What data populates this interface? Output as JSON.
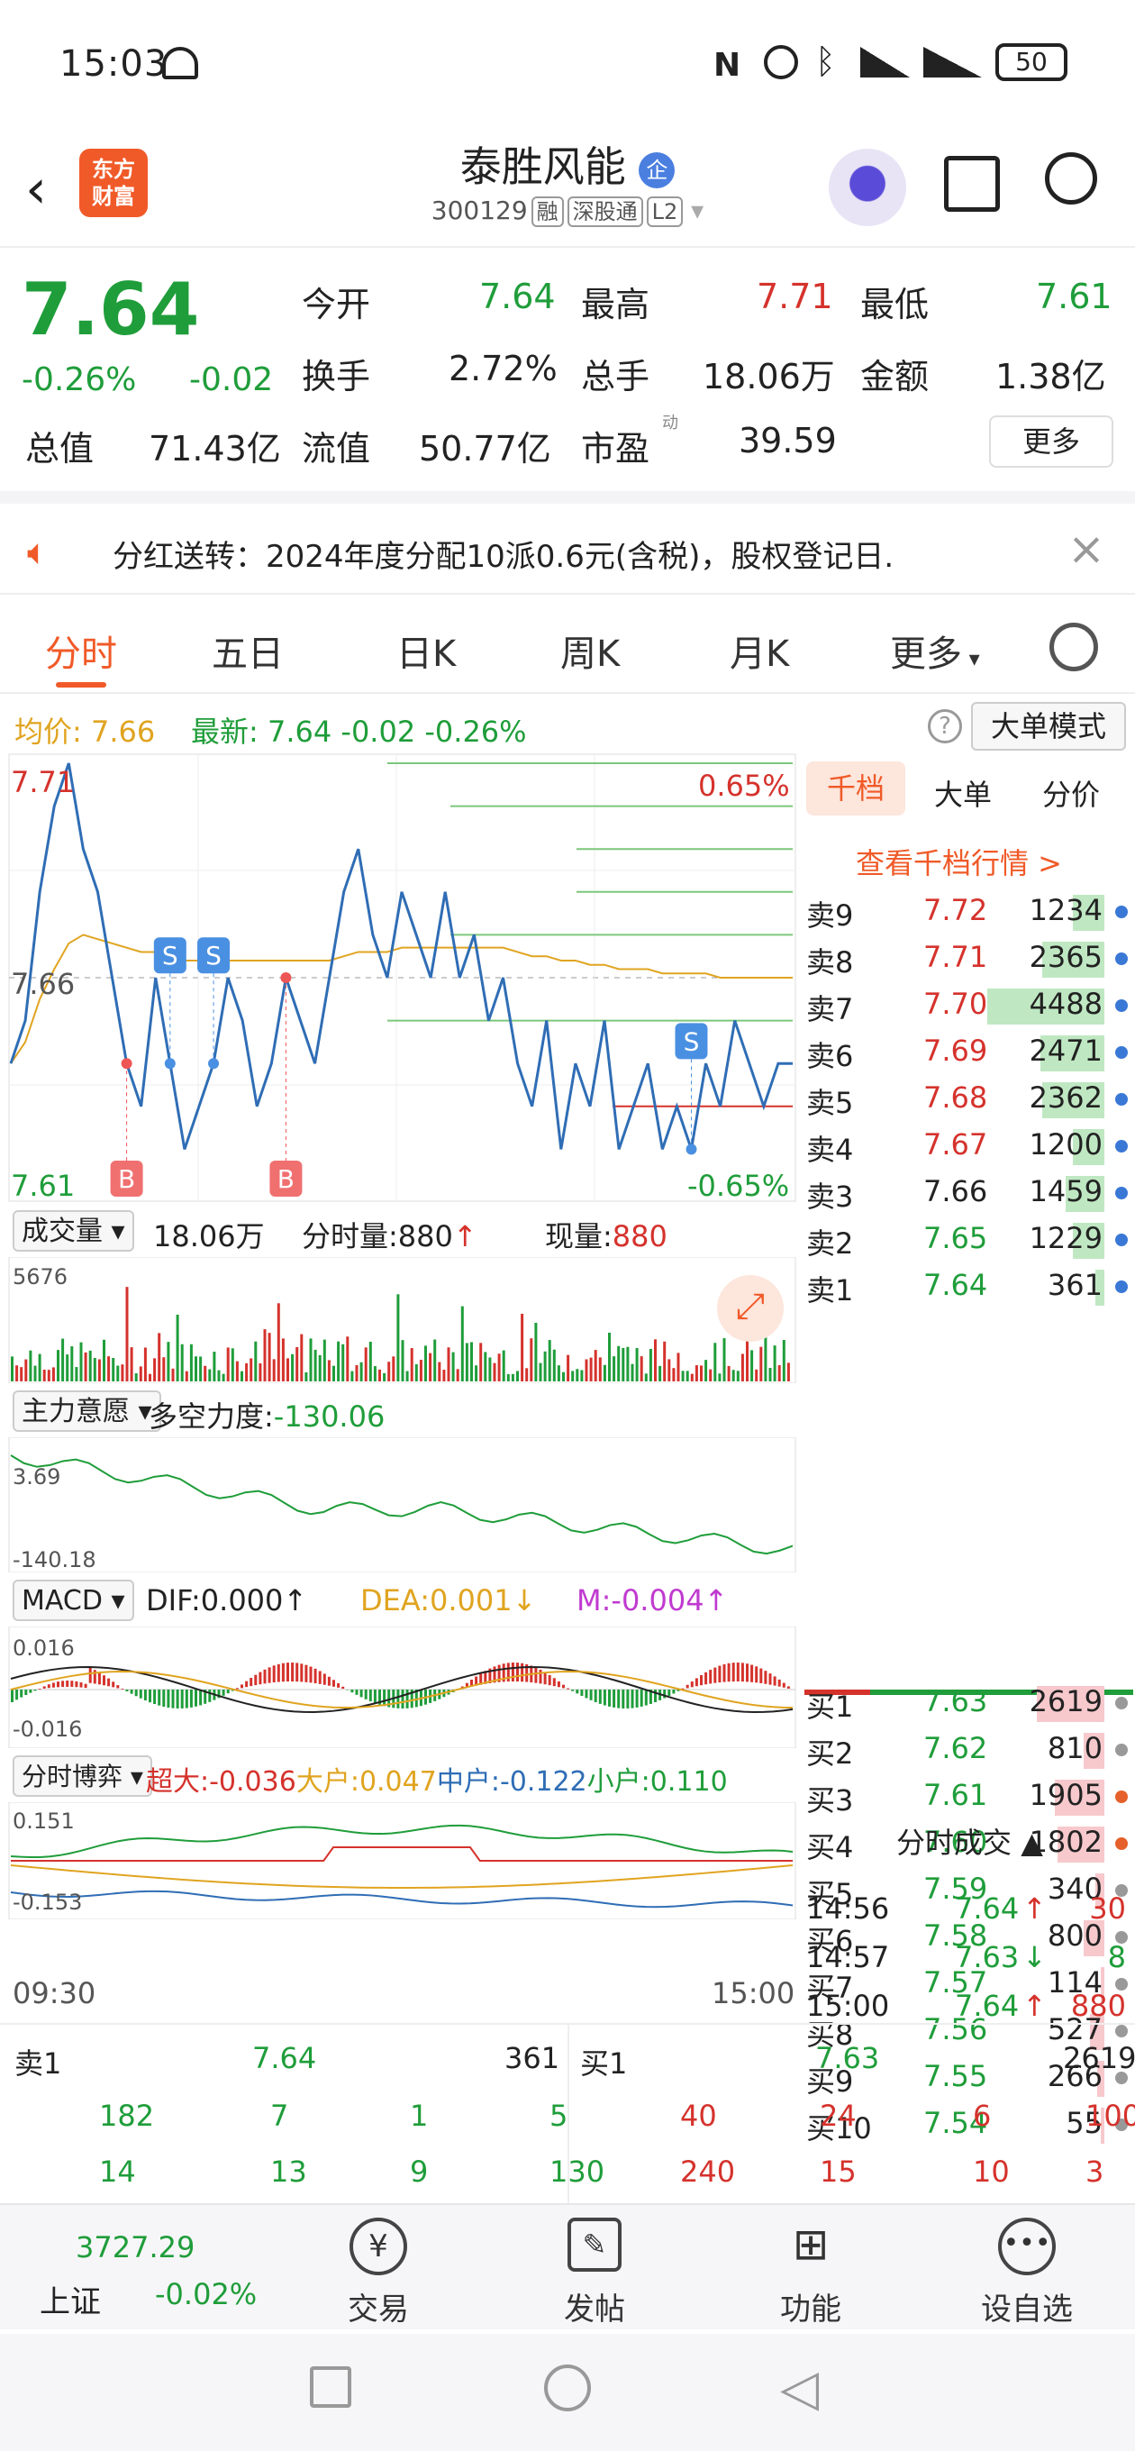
{
  "status": {
    "time": "15:03",
    "battery": "50"
  },
  "header": {
    "logo_line1": "东方",
    "logo_line2": "财富",
    "stock_name": "泰胜风能",
    "badge": "企",
    "code": "300129",
    "tags": [
      "融",
      "深股通",
      "L2"
    ]
  },
  "quote": {
    "price": "7.64",
    "change_pct": "-0.26%",
    "change": "-0.02",
    "open_label": "今开",
    "open": "7.64",
    "high_label": "最高",
    "high": "7.71",
    "low_label": "最低",
    "low": "7.61",
    "turnover_label": "换手",
    "turnover": "2.72%",
    "volume_label": "总手",
    "volume": "18.06万",
    "amount_label": "金额",
    "amount": "1.38亿",
    "mcap_label": "总值",
    "mcap": "71.43亿",
    "float_label": "流值",
    "float": "50.77亿",
    "pe_label": "市盈",
    "pe_sup": "动",
    "pe": "39.59",
    "more": "更多"
  },
  "notice": {
    "text": "分红送转：2024年度分配10派0.6元(含税)，股权登记日."
  },
  "tabs": [
    "分时",
    "五日",
    "日K",
    "周K",
    "月K",
    "更多"
  ],
  "legend": {
    "avg_label": "均价:",
    "avg": "7.66",
    "latest_label": "最新:",
    "latest": "7.64",
    "chg": "-0.02",
    "chg_pct": "-0.26%",
    "mode": "大单模式"
  },
  "chart": {
    "y_high": "7.71",
    "y_mid": "7.66",
    "y_low": "7.61",
    "pct_high": "0.65%",
    "pct_low": "-0.65%",
    "time_start": "09:30",
    "time_end": "15:00",
    "sell_marker": "S",
    "buy_marker": "B",
    "price_series": [
      7.64,
      7.65,
      7.68,
      7.7,
      7.71,
      7.69,
      7.68,
      7.66,
      7.64,
      7.63,
      7.66,
      7.64,
      7.62,
      7.63,
      7.64,
      7.66,
      7.65,
      7.63,
      7.64,
      7.66,
      7.65,
      7.64,
      7.66,
      7.68,
      7.69,
      7.67,
      7.66,
      7.68,
      7.67,
      7.66,
      7.68,
      7.66,
      7.67,
      7.65,
      7.66,
      7.64,
      7.63,
      7.65,
      7.62,
      7.64,
      7.63,
      7.65,
      7.62,
      7.63,
      7.64,
      7.62,
      7.63,
      7.62,
      7.64,
      7.63,
      7.65,
      7.64,
      7.63,
      7.64,
      7.64
    ],
    "avg_series": [
      7.64,
      7.645,
      7.655,
      7.662,
      7.668,
      7.67,
      7.669,
      7.668,
      7.667,
      7.666,
      7.666,
      7.665,
      7.664,
      7.664,
      7.664,
      7.664,
      7.664,
      7.664,
      7.664,
      7.664,
      7.664,
      7.664,
      7.664,
      7.665,
      7.666,
      7.666,
      7.666,
      7.667,
      7.667,
      7.667,
      7.667,
      7.667,
      7.667,
      7.667,
      7.667,
      7.666,
      7.665,
      7.665,
      7.664,
      7.664,
      7.663,
      7.663,
      7.662,
      7.662,
      7.662,
      7.661,
      7.661,
      7.661,
      7.661,
      7.66,
      7.66,
      7.66,
      7.66,
      7.66,
      7.66
    ]
  },
  "volume": {
    "label": "成交量",
    "total": "18.06万",
    "fs_label": "分时量:",
    "fs_value": "880",
    "now_label": "现量:",
    "now_value": "880",
    "max": "5676"
  },
  "main_force": {
    "label": "主力意愿",
    "title": "多空力度:",
    "value": "-130.06",
    "top": "3.69",
    "bottom": "-140.18"
  },
  "macd": {
    "label": "MACD",
    "dif": "DIF:0.000",
    "dea": "DEA:0.001",
    "m": "M:-0.004",
    "top": "0.016",
    "bottom": "-0.016"
  },
  "game": {
    "label": "分时博弈",
    "super_label": "超大:",
    "super": "-0.036",
    "big_label": "大户:",
    "big": "0.047",
    "mid_label": "中户:",
    "mid": "-0.122",
    "small_label": "小户:",
    "small": "0.110",
    "top": "0.151",
    "bottom": "-0.153"
  },
  "orderbook": {
    "tabs": [
      "千档",
      "大单",
      "分价"
    ],
    "link": "查看千档行情 >",
    "asks": [
      {
        "label": "卖9",
        "price": "7.72",
        "vol": "1234",
        "pct": 0.27
      },
      {
        "label": "卖8",
        "price": "7.71",
        "vol": "2365",
        "pct": 0.53
      },
      {
        "label": "卖7",
        "price": "7.70",
        "vol": "4488",
        "pct": 1.0
      },
      {
        "label": "卖6",
        "price": "7.69",
        "vol": "2471",
        "pct": 0.55
      },
      {
        "label": "卖5",
        "price": "7.68",
        "vol": "2362",
        "pct": 0.53
      },
      {
        "label": "卖4",
        "price": "7.67",
        "vol": "1200",
        "pct": 0.27
      },
      {
        "label": "卖3",
        "price": "7.66",
        "vol": "1459",
        "pct": 0.33
      },
      {
        "label": "卖2",
        "price": "7.65",
        "vol": "1229",
        "pct": 0.27
      },
      {
        "label": "卖1",
        "price": "7.64",
        "vol": "361",
        "pct": 0.08
      }
    ],
    "bids": [
      {
        "label": "买1",
        "price": "7.63",
        "vol": "2619",
        "pct": 0.58
      },
      {
        "label": "买2",
        "price": "7.62",
        "vol": "810",
        "pct": 0.18
      },
      {
        "label": "买3",
        "price": "7.61",
        "vol": "1905",
        "pct": 0.42
      },
      {
        "label": "买4",
        "price": "7.60",
        "vol": "1802",
        "pct": 0.4
      },
      {
        "label": "买5",
        "price": "7.59",
        "vol": "340",
        "pct": 0.08
      },
      {
        "label": "买6",
        "price": "7.58",
        "vol": "800",
        "pct": 0.18
      },
      {
        "label": "买7",
        "price": "7.57",
        "vol": "114",
        "pct": 0.03
      },
      {
        "label": "买8",
        "price": "7.56",
        "vol": "527",
        "pct": 0.12
      },
      {
        "label": "买9",
        "price": "7.55",
        "vol": "266",
        "pct": 0.06
      },
      {
        "label": "买10",
        "price": "7.54",
        "vol": "55",
        "pct": 0.01
      }
    ],
    "trades_title": "分时成交",
    "trades": [
      {
        "time": "14:56",
        "price": "7.64",
        "dir": "↑",
        "vol": "30"
      },
      {
        "time": "14:57",
        "price": "7.63",
        "dir": "↓",
        "vol": "8"
      },
      {
        "time": "15:00",
        "price": "7.64",
        "dir": "↑",
        "vol": "880"
      }
    ]
  },
  "bottom": {
    "sell_label": "卖1",
    "sell_price": "7.64",
    "sell_vol": "361",
    "buy_label": "买1",
    "buy_price": "7.63",
    "buy_vol": "2619",
    "sell_q1": [
      "182",
      "7",
      "1",
      "5"
    ],
    "sell_q2": [
      "14",
      "13",
      "9",
      "130"
    ],
    "buy_q1": [
      "40",
      "24",
      "6",
      "100"
    ],
    "buy_q2": [
      "240",
      "15",
      "10",
      "3"
    ]
  },
  "nav": {
    "index_value": "3727.29",
    "index_name": "上证",
    "index_chg": "-0.02%",
    "items": [
      "交易",
      "发帖",
      "功能",
      "设自选"
    ]
  },
  "colors": {
    "up": "#d5322c",
    "down": "#1f9d3a",
    "line": "#2f6db5",
    "avg": "#e0a420",
    "accent": "#f05a28"
  }
}
